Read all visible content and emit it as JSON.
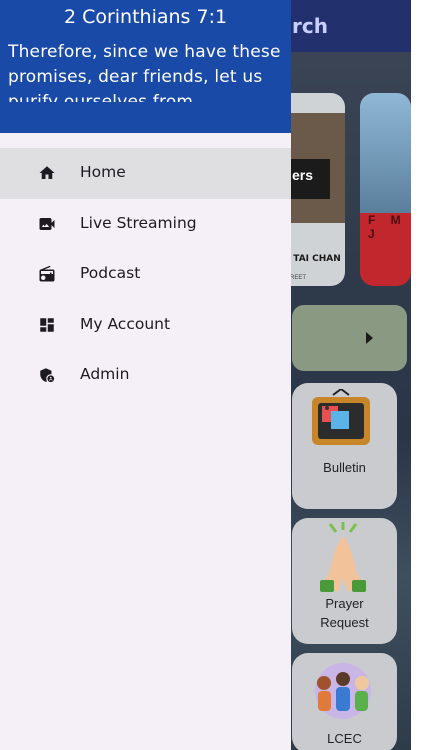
{
  "background": {
    "header_fragment": "rch",
    "card1": {
      "overlay_text": "ers",
      "caption": "NG TAI CHAN",
      "subcaption": "REET"
    },
    "card2": {
      "letters": "F M J"
    },
    "tiles": [
      {
        "label": "Bulletin"
      },
      {
        "label_line1": "Prayer",
        "label_line2": "Request"
      },
      {
        "label": "LCEC"
      }
    ]
  },
  "drawer": {
    "verse_reference": "2 Corinthians 7:1",
    "verse_text": "Therefore, since we have these promises, dear friends, let us purify ourselves from everything",
    "nav_items": [
      {
        "label": "Home",
        "icon": "home-icon",
        "active": true
      },
      {
        "label": "Live Streaming",
        "icon": "video-camera-icon",
        "active": false
      },
      {
        "label": "Podcast",
        "icon": "radio-icon",
        "active": false
      },
      {
        "label": "My Account",
        "icon": "dashboard-icon",
        "active": false
      },
      {
        "label": "Admin",
        "icon": "admin-shield-icon",
        "active": false
      }
    ]
  },
  "colors": {
    "drawer_header": "#1a4aa8",
    "drawer_background": "#f5f0f7",
    "active_item": "#dfdfe2"
  }
}
